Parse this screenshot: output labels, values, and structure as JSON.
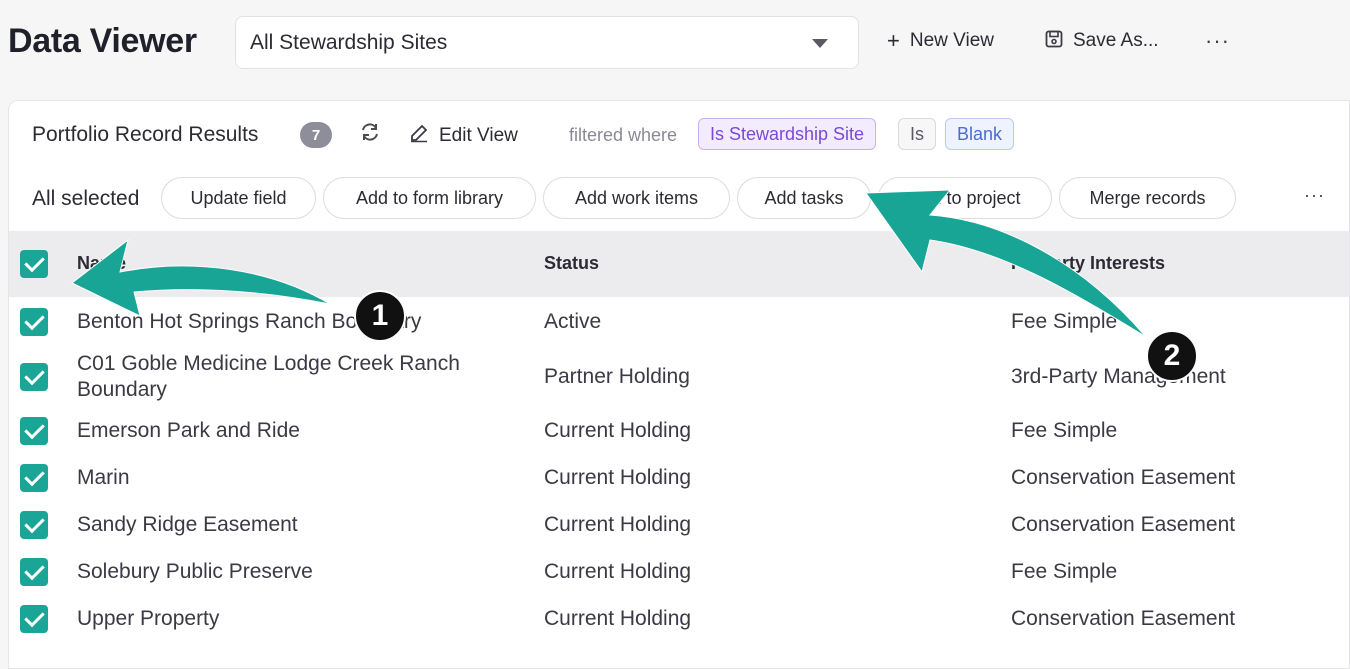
{
  "header": {
    "title": "Data Viewer",
    "view_select": "All Stewardship Sites",
    "new_view_label": "New View",
    "save_as_label": "Save As...",
    "more_label": "···"
  },
  "results": {
    "title": "Portfolio Record Results",
    "count": "7",
    "edit_view_label": "Edit View",
    "filtered_label": "filtered where",
    "filter_field": "Is Stewardship Site",
    "filter_operator": "Is",
    "filter_value": "Blank"
  },
  "actions": {
    "all_selected": "All selected",
    "buttons": [
      "Update field",
      "Add to form library",
      "Add work items",
      "Add tasks",
      "Add to project",
      "Merge records"
    ],
    "more_label": "···"
  },
  "table": {
    "columns": [
      "Name",
      "Status",
      "Property Interests"
    ],
    "rows": [
      {
        "name": "Benton Hot Springs Ranch Boundary",
        "status": "Active",
        "interest": "Fee Simple",
        "checked": true
      },
      {
        "name": "C01 Goble Medicine Lodge Creek Ranch Boundary",
        "status": "Partner Holding",
        "interest": "3rd-Party Management",
        "checked": true
      },
      {
        "name": "Emerson Park and Ride",
        "status": "Current Holding",
        "interest": "Fee Simple",
        "checked": true
      },
      {
        "name": "Marin",
        "status": "Current Holding",
        "interest": "Conservation Easement",
        "checked": true
      },
      {
        "name": "Sandy Ridge Easement",
        "status": "Current Holding",
        "interest": "Conservation Easement",
        "checked": true
      },
      {
        "name": "Solebury Public Preserve",
        "status": "Current Holding",
        "interest": "Fee Simple",
        "checked": true
      },
      {
        "name": "Upper Property",
        "status": "Current Holding",
        "interest": "Conservation Easement",
        "checked": true
      }
    ]
  },
  "annotations": {
    "marker_1": "1",
    "marker_2": "2",
    "arrow_color": "#18a596"
  },
  "colors": {
    "accent": "#1aa596",
    "filter_field": "#7a4ad6",
    "filter_value": "#4a6ed0"
  }
}
